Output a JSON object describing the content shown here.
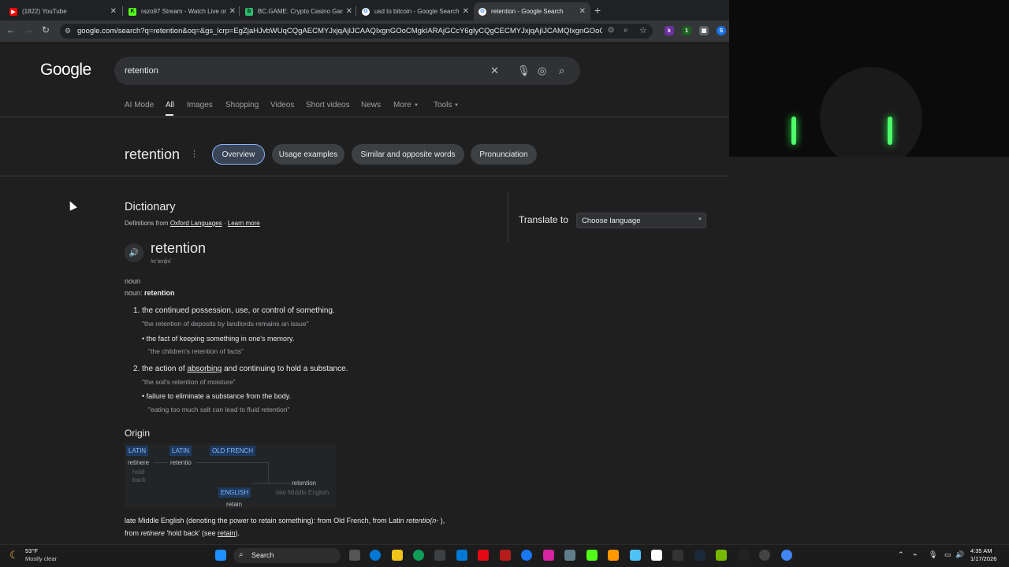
{
  "browser": {
    "tabs": [
      {
        "title": "(1822) YouTube",
        "favicon": "youtube-icon",
        "color": "#ff0000"
      },
      {
        "title": "razo97 Stream - Watch Live on",
        "favicon": "kick-icon",
        "color": "#53fc18"
      },
      {
        "title": "BC.GAME: Crypto Casino Gam",
        "favicon": "bcgame-icon",
        "color": "#2dbd6e"
      },
      {
        "title": "usd to bitcoin - Google Search",
        "favicon": "google-icon",
        "color": "#8ab4f8"
      },
      {
        "title": "retention - Google Search",
        "favicon": "google-icon",
        "color": "#8ab4f8"
      }
    ],
    "active_tab": 4,
    "url": "google.com/search?q=retention&oq=&gs_lcrp=EgZjaHJvbWUqCQgAECMYJxjqAjIJCAAQIxgnGOoCMgkIARAjGCcY6gIyCQgCECMYJxjqAjIJCAMQIxgnGOoCMgkIBBAjGCcY6..."
  },
  "search": {
    "logo": "Google",
    "query": "retention",
    "tabs": [
      "AI Mode",
      "All",
      "Images",
      "Shopping",
      "Videos",
      "Short videos",
      "News",
      "More",
      "Tools"
    ],
    "active_tab": "All"
  },
  "word": {
    "title": "retention",
    "chips": [
      "Overview",
      "Usage examples",
      "Similar and opposite words",
      "Pronunciation"
    ],
    "selected_chip": "Overview"
  },
  "dictionary": {
    "heading": "Dictionary",
    "source_prefix": "Definitions from",
    "source": "Oxford Languages",
    "learn_more": "Learn more",
    "headword": "retention",
    "phonetic": "/rɪˈtɛnʃn/",
    "pos": "noun",
    "noun_label": "noun:",
    "noun_word": "retention",
    "defs": [
      {
        "num": "1.",
        "text": "the continued possession, use, or control of something.",
        "example": "\"the retention of deposits by landlords remains an issue\"",
        "sub": "the fact of keeping something in one's memory.",
        "sub_example": "\"the children's retention of facts\""
      },
      {
        "num": "2.",
        "text_pre": "the action of",
        "text_link": "absorbing",
        "text_post": "and continuing to hold a substance.",
        "example": "\"the soil's retention of moisture\"",
        "sub": "failure to eliminate a substance from the body.",
        "sub_example": "\"eating too much salt can lead to fluid retention\""
      }
    ]
  },
  "translate": {
    "label": "Translate to",
    "select": "Choose language"
  },
  "origin": {
    "heading": "Origin",
    "lang1": "LATIN",
    "lang2": "LATIN",
    "lang3": "OLD FRENCH",
    "lang4": "ENGLISH",
    "w1": "retinere",
    "w1_gloss_a": "hold",
    "w1_gloss_b": "back",
    "w2": "retentio",
    "w3": "retention",
    "w3_gloss": "late Middle English",
    "w4": "retain",
    "text1_a": "late Middle English (denoting the power to retain something): from Old French, from Latin",
    "text1_b": "retentio(n- ",
    "text1_c": "),",
    "text2_a": "from",
    "text2_b": "retinere",
    "text2_c": "'hold back' (see",
    "text2_d": "retain",
    "text2_e": ")."
  },
  "taskbar": {
    "temp": "53°F",
    "weather": "Mostly clear",
    "search_label": "Search",
    "time": "4:35 AM",
    "date": "1/17/2026"
  }
}
